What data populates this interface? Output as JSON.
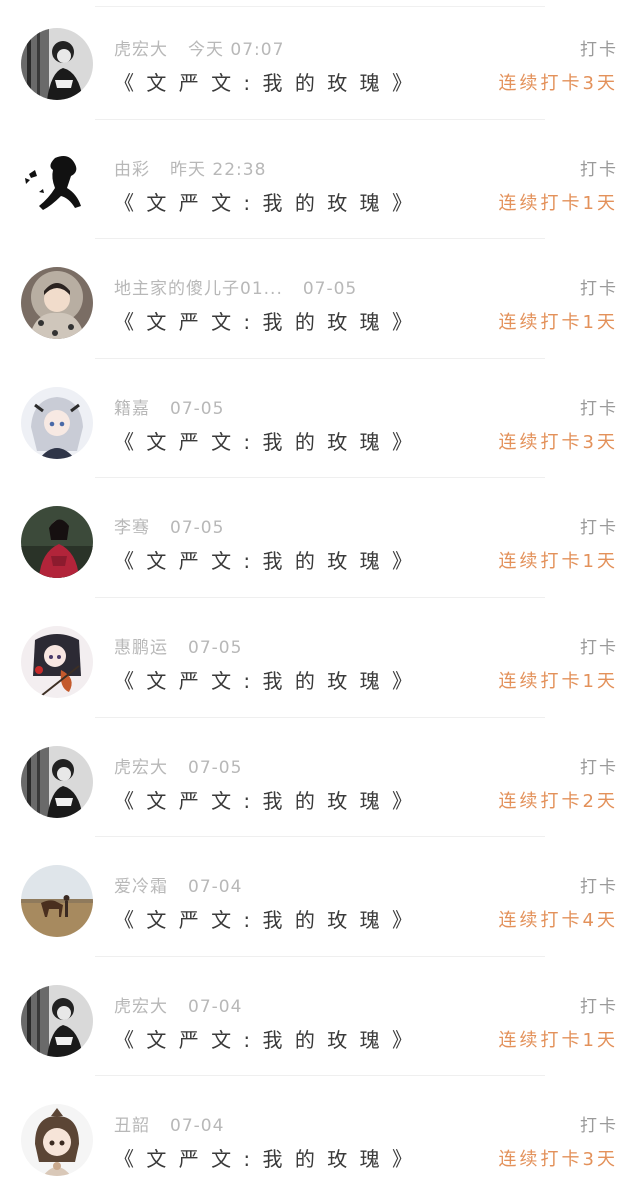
{
  "checkins": [
    {
      "user": "虎宏大",
      "time": "今天 07:07",
      "title": "《 文 严 文 : 我 的 玫 瑰 》",
      "action": "打卡",
      "streak": "连续打卡3天",
      "avatar": "avatar-woman-bw-icon"
    },
    {
      "user": "由彩",
      "time": "昨天 22:38",
      "title": "《 文 严 文 : 我 的 玫 瑰 》",
      "action": "打卡",
      "streak": "连续打卡1天",
      "avatar": "avatar-silhouette-butterfly-icon"
    },
    {
      "user": "地主家的傻儿子01...",
      "time": "07-05",
      "title": "《 文 严 文 : 我 的 玫 瑰 》",
      "action": "打卡",
      "streak": "连续打卡1天",
      "avatar": "avatar-hooded-girl-icon"
    },
    {
      "user": "籍嘉",
      "time": "07-05",
      "title": "《 文 严 文 : 我 的 玫 瑰 》",
      "action": "打卡",
      "streak": "连续打卡3天",
      "avatar": "avatar-anime-silver-hair-icon"
    },
    {
      "user": "李骞",
      "time": "07-05",
      "title": "《 文 严 文 : 我 的 玫 瑰 》",
      "action": "打卡",
      "streak": "连续打卡1天",
      "avatar": "avatar-woman-red-dress-icon"
    },
    {
      "user": "惠鹏运",
      "time": "07-05",
      "title": "《 文 严 文 : 我 的 玫 瑰 》",
      "action": "打卡",
      "streak": "连续打卡1天",
      "avatar": "avatar-anime-violin-icon"
    },
    {
      "user": "虎宏大",
      "time": "07-05",
      "title": "《 文 严 文 : 我 的 玫 瑰 》",
      "action": "打卡",
      "streak": "连续打卡2天",
      "avatar": "avatar-woman-bw-icon"
    },
    {
      "user": "爱冷霜",
      "time": "07-04",
      "title": "《 文 严 文 : 我 的 玫 瑰 》",
      "action": "打卡",
      "streak": "连续打卡4天",
      "avatar": "avatar-horse-landscape-icon"
    },
    {
      "user": "虎宏大",
      "time": "07-04",
      "title": "《 文 严 文 : 我 的 玫 瑰 》",
      "action": "打卡",
      "streak": "连续打卡1天",
      "avatar": "avatar-woman-bw-icon"
    },
    {
      "user": "丑韶",
      "time": "07-04",
      "title": "《 文 严 文 : 我 的 玫 瑰 》",
      "action": "打卡",
      "streak": "连续打卡3天",
      "avatar": "avatar-anime-girl-icon"
    }
  ],
  "colors": {
    "streak": "#e3915a",
    "meta": "#b8b8b8",
    "title": "#3a3a3a",
    "action": "#9a9a9a"
  }
}
